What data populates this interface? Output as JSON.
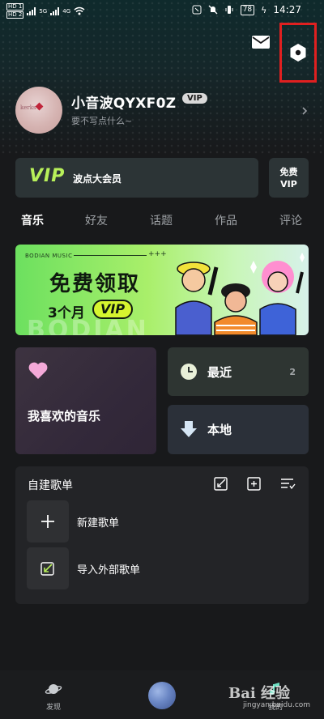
{
  "status_bar": {
    "sim1": "HD 1",
    "sim2": "HD 2",
    "net1": "5G",
    "net2": "4G",
    "battery": "78",
    "time": "14:27"
  },
  "header": {
    "mail_icon": "mail-icon",
    "settings_icon": "settings-hexagon-icon",
    "highlight_color": "#e02020"
  },
  "profile": {
    "username": "小音波QYXF0Z",
    "vip_badge": "VIP",
    "bio": "要不写点什么~",
    "avatar_scribble": "kerks"
  },
  "vip_card": {
    "logo": "VIP",
    "label": "波点大会员",
    "free_line1": "免费",
    "free_line2": "VIP",
    "accent": "#b8f05a"
  },
  "tabs": [
    {
      "label": "音乐",
      "active": true
    },
    {
      "label": "好友",
      "active": false
    },
    {
      "label": "话题",
      "active": false
    },
    {
      "label": "作品",
      "active": false
    },
    {
      "label": "评论",
      "active": false
    }
  ],
  "banner": {
    "brand": "BODIAN MUSIC",
    "ornament": "+++",
    "headline": "免费领取",
    "months": "3个月",
    "vip": "VIP",
    "ghost_text": "BODIAN"
  },
  "tiles": {
    "favorites": {
      "label": "我喜欢的音乐",
      "icon": "heart-icon"
    },
    "recent": {
      "label": "最近",
      "count": "2",
      "icon": "clock-icon"
    },
    "local": {
      "label": "本地",
      "icon": "download-arrow-icon"
    }
  },
  "playlists": {
    "title": "自建歌单",
    "actions": [
      "edit-icon",
      "add-icon",
      "sort-icon"
    ],
    "items": [
      {
        "label": "新建歌单",
        "icon": "plus-icon"
      },
      {
        "label": "导入外部歌单",
        "icon": "import-icon"
      }
    ]
  },
  "bottom_nav": {
    "discover": "发现",
    "mine": "我的",
    "watermark": "Bai 经验",
    "watermark_sub": "jingyan.baidu.com"
  }
}
